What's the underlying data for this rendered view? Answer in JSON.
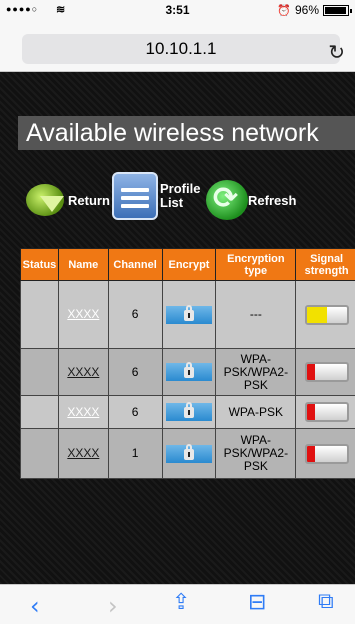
{
  "status_bar": {
    "signal_dots": "●●●●○",
    "wifi": "≋",
    "time": "3:51",
    "battery_text": "96%",
    "alarm": "⏰"
  },
  "browser": {
    "url": "10.10.1.1",
    "reload_glyph": "↻"
  },
  "page": {
    "title": "Available wireless network",
    "actions": {
      "return_label": "Return",
      "profile_label_line1": "Profile",
      "profile_label_line2": "List",
      "refresh_label": "Refresh"
    }
  },
  "table": {
    "headers": [
      "Status",
      "Name",
      "Channel",
      "Encrypt",
      "Encryption type",
      "Signal strength"
    ],
    "rows": [
      {
        "status": "",
        "name": "XXXX",
        "channel": "6",
        "encryption_type": "---",
        "signal_fraction": 0.5,
        "signal_color": "#f2e100"
      },
      {
        "status": "",
        "name": "XXXX",
        "channel": "6",
        "encryption_type": "WPA-PSK/WPA2-PSK",
        "signal_fraction": 0.2,
        "signal_color": "#e01010"
      },
      {
        "status": "",
        "name": "XXXX",
        "channel": "6",
        "encryption_type": "WPA-PSK",
        "signal_fraction": 0.2,
        "signal_color": "#e01010"
      },
      {
        "status": "",
        "name": "XXXX",
        "channel": "1",
        "encryption_type": "WPA-PSK/WPA2-PSK",
        "signal_fraction": 0.2,
        "signal_color": "#e01010"
      }
    ]
  },
  "toolbar": {
    "back": "‹",
    "forward": "›",
    "share": "⇪",
    "bookmarks": "⊟",
    "tabs": "⧉"
  },
  "colors": {
    "header_orange": "#f07814",
    "accent_blue": "#2f7cf6"
  }
}
